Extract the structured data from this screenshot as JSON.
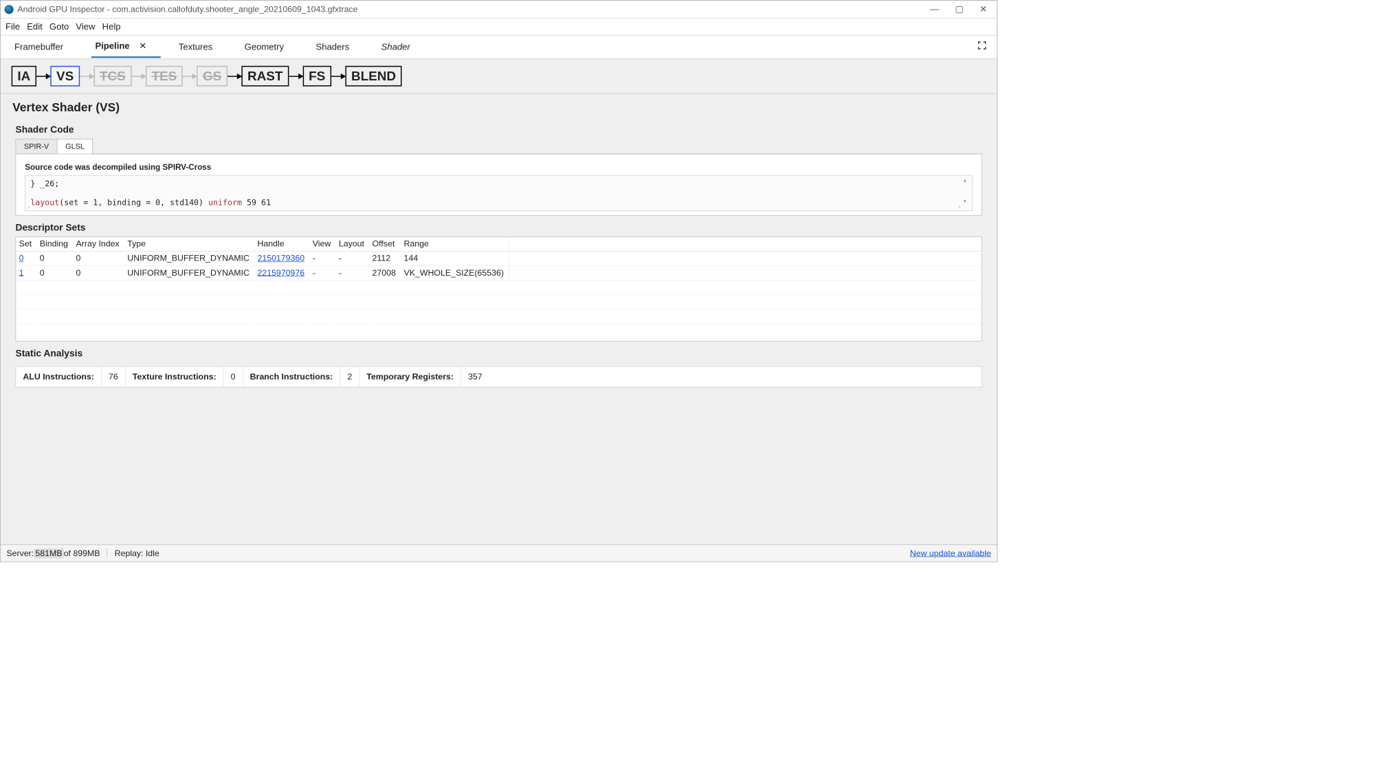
{
  "window": {
    "title": "Android GPU Inspector - com.activision.callofduty.shooter_angle_20210609_1043.gfxtrace"
  },
  "menu": {
    "file": "File",
    "edit": "Edit",
    "goto": "Goto",
    "view": "View",
    "help": "Help"
  },
  "tabs": {
    "framebuffer": "Framebuffer",
    "pipeline": "Pipeline",
    "textures": "Textures",
    "geometry": "Geometry",
    "shaders": "Shaders",
    "shader": "Shader"
  },
  "pipeline": {
    "ia": "IA",
    "vs": "VS",
    "tcs": "TCS",
    "tes": "TES",
    "gs": "GS",
    "rast": "RAST",
    "fs": "FS",
    "blend": "BLEND"
  },
  "headings": {
    "main": "Vertex Shader (VS)",
    "shader_code": "Shader Code",
    "descriptor_sets": "Descriptor Sets",
    "static_analysis": "Static Analysis"
  },
  "shader_tabs": {
    "spirv": "SPIR-V",
    "glsl": "GLSL"
  },
  "code": {
    "caption": "Source code was decompiled using SPIRV-Cross",
    "line1_a": "} ",
    "line1_b": "_26;",
    "line2_kw": "layout",
    "line2_mid": "(set = 1, binding = 0, std140) ",
    "line2_uni": "uniform",
    "line2_end": "  59 61"
  },
  "desc_table": {
    "cols": {
      "set": "Set",
      "binding": "Binding",
      "array_index": "Array Index",
      "type": "Type",
      "handle": "Handle",
      "view": "View",
      "layout": "Layout",
      "offset": "Offset",
      "range": "Range"
    },
    "rows": [
      {
        "set": "0",
        "binding": "0",
        "array_index": "0",
        "type": "UNIFORM_BUFFER_DYNAMIC",
        "handle": "2150179360",
        "view": "-",
        "layout": "-",
        "offset": "2112",
        "range": "144"
      },
      {
        "set": "1",
        "binding": "0",
        "array_index": "0",
        "type": "UNIFORM_BUFFER_DYNAMIC",
        "handle": "2215970976",
        "view": "-",
        "layout": "-",
        "offset": "27008",
        "range": "VK_WHOLE_SIZE(65536)"
      }
    ]
  },
  "static_analysis": {
    "alu_label": "ALU Instructions:",
    "alu": "76",
    "tex_label": "Texture Instructions:",
    "tex": "0",
    "branch_label": "Branch Instructions:",
    "branch": "2",
    "temp_label": "Temporary Registers:",
    "temp": "357"
  },
  "status": {
    "server_prefix": "Server: ",
    "server_mem": "581MB",
    "server_of": " of 899MB",
    "replay": "Replay: Idle",
    "update": "New update available"
  }
}
